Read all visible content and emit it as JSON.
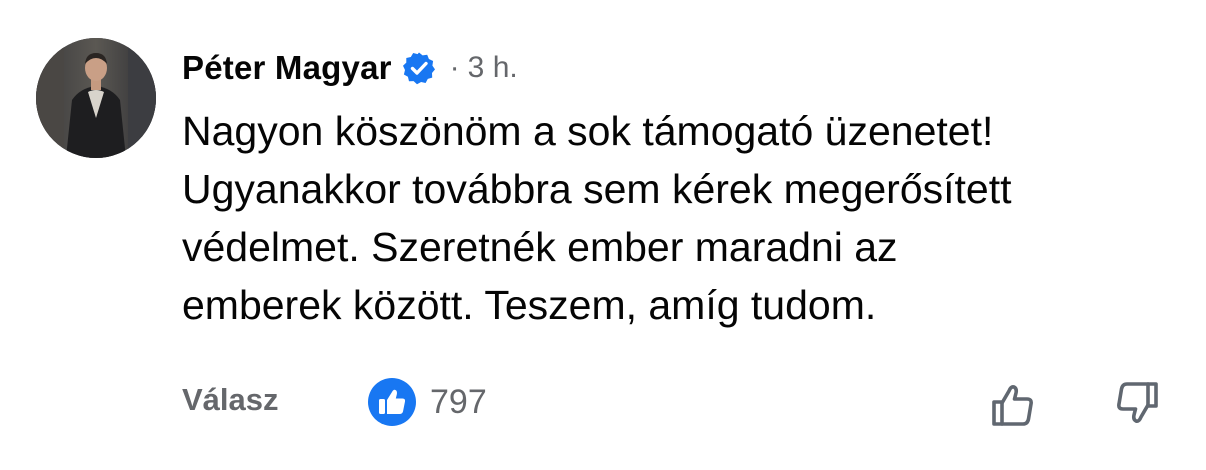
{
  "comment": {
    "author": {
      "name": "Péter Magyar",
      "verified": true,
      "verified_badge_color": "#1877f2"
    },
    "separator": "·",
    "timestamp": "3 h.",
    "text_lines": [
      "Nagyon köszönöm a sok támogató üzenetet!",
      "Ugyanakkor továbbra sem kérek megerősített",
      "védelmet. Szeretnék ember maradni az",
      "emberek között. Teszem, amíg tudom."
    ],
    "actions": {
      "reply_label": "Válasz",
      "reaction_icon": "thumbs-up-badge-icon",
      "reaction_color": "#1877f2",
      "reaction_count": "797",
      "like_icon": "thumbs-up-outline-icon",
      "dislike_icon": "thumbs-down-outline-icon"
    }
  }
}
